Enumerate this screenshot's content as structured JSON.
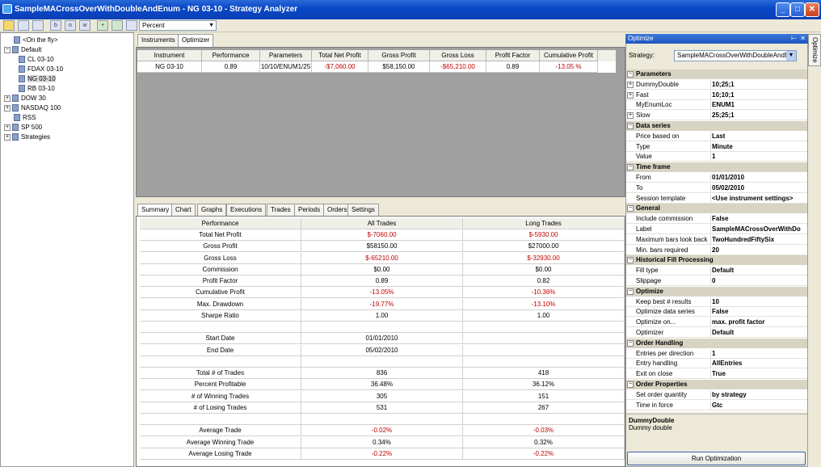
{
  "window": {
    "title": "SampleMACrossOverWithDoubleAndEnum - NG 03-10 - Strategy Analyzer"
  },
  "toolbar": {
    "combo_value": "Percent"
  },
  "tree": [
    {
      "label": "<On the fly>",
      "level": 0
    },
    {
      "label": "Default",
      "level": 0
    },
    {
      "label": "CL 03-10",
      "level": 1
    },
    {
      "label": "FDAX 03-10",
      "level": 1
    },
    {
      "label": "NG 03-10",
      "level": 1
    },
    {
      "label": "RB 03-10",
      "level": 1
    },
    {
      "label": "DOW 30",
      "level": 0
    },
    {
      "label": "NASDAQ 100",
      "level": 0
    },
    {
      "label": "RSS",
      "level": 0
    },
    {
      "label": "SP 500",
      "level": 0
    },
    {
      "label": "Strategies",
      "level": 0
    }
  ],
  "top_tabs": [
    "Instruments",
    "Optimizer"
  ],
  "optimizer_table": {
    "headers": [
      "Instrument",
      "Performance",
      "Parameters",
      "Total Net Profit",
      "Gross Profit",
      "Gross Loss",
      "Profit Factor",
      "Cumulative Profit"
    ],
    "row": [
      "NG 03-10",
      "0.89",
      "10/10/ENUM1/25",
      "-$7,060.00",
      "$58,150.00",
      "-$65,210.00",
      "0.89",
      "-13.05 %"
    ]
  },
  "bottom_tabs": [
    "Summary",
    "Chart",
    "Graphs",
    "Executions",
    "Trades",
    "Periods",
    "Orders",
    "Settings"
  ],
  "summary": {
    "headers": [
      "Performance",
      "All Trades",
      "Long Trades"
    ],
    "rows": [
      [
        "Total Net Profit",
        "$-7060.00",
        "$-5930.00"
      ],
      [
        "Gross Profit",
        "$58150.00",
        "$27000.00"
      ],
      [
        "Gross Loss",
        "$-65210.00",
        "$-32930.00"
      ],
      [
        "Commission",
        "$0.00",
        "$0.00"
      ],
      [
        "Profit Factor",
        "0.89",
        "0.82"
      ],
      [
        "Cumulative Profit",
        "-13.05%",
        "-10.36%"
      ],
      [
        "Max. Drawdown",
        "-19.77%",
        "-13.10%"
      ],
      [
        "Sharpe Ratio",
        "1.00",
        "1.00"
      ],
      [
        "",
        "",
        ""
      ],
      [
        "Start Date",
        "01/01/2010",
        ""
      ],
      [
        "End Date",
        "05/02/2010",
        ""
      ],
      [
        "",
        "",
        ""
      ],
      [
        "Total # of Trades",
        "836",
        "418"
      ],
      [
        "Percent Profitable",
        "36.48%",
        "36.12%"
      ],
      [
        "# of Winning Trades",
        "305",
        "151"
      ],
      [
        "# of Losing Trades",
        "531",
        "267"
      ],
      [
        "",
        "",
        ""
      ],
      [
        "Average Trade",
        "-0.02%",
        "-0.03%"
      ],
      [
        "Average Winning Trade",
        "0.34%",
        "0.32%"
      ],
      [
        "Average Losing Trade",
        "-0.22%",
        "-0.22%"
      ]
    ]
  },
  "optimize_panel": {
    "title": "Optimize",
    "side_tab": "Optimize",
    "strategy_label": "Strategy:",
    "strategy_value": "SampleMACrossOverWithDoubleAndE",
    "grid": [
      {
        "cat": "Parameters"
      },
      {
        "k": "DummyDouble",
        "v": "10;25;1",
        "exp": true
      },
      {
        "k": "Fast",
        "v": "10;10;1",
        "exp": true
      },
      {
        "k": "MyEnumLoc",
        "v": "ENUM1"
      },
      {
        "k": "Slow",
        "v": "25;25;1",
        "exp": true
      },
      {
        "cat": "Data series"
      },
      {
        "k": "Price based on",
        "v": "Last"
      },
      {
        "k": "Type",
        "v": "Minute"
      },
      {
        "k": "Value",
        "v": "1"
      },
      {
        "cat": "Time frame"
      },
      {
        "k": "From",
        "v": "01/01/2010"
      },
      {
        "k": "To",
        "v": "05/02/2010"
      },
      {
        "k": "Session template",
        "v": "<Use instrument settings>"
      },
      {
        "cat": "General"
      },
      {
        "k": "Include commission",
        "v": "False"
      },
      {
        "k": "Label",
        "v": "SampleMACrossOverWithDo"
      },
      {
        "k": "Maximum bars look back",
        "v": "TwoHundredFiftySix"
      },
      {
        "k": "Min. bars required",
        "v": "20"
      },
      {
        "cat": "Historical Fill Processing"
      },
      {
        "k": "Fill type",
        "v": "Default"
      },
      {
        "k": "Slippage",
        "v": "0"
      },
      {
        "cat": "Optimize"
      },
      {
        "k": "Keep best # results",
        "v": "10"
      },
      {
        "k": "Optimize data series",
        "v": "False"
      },
      {
        "k": "Optimize on...",
        "v": "max. profit factor"
      },
      {
        "k": "Optimizer",
        "v": "Default"
      },
      {
        "cat": "Order Handling"
      },
      {
        "k": "Entries per direction",
        "v": "1"
      },
      {
        "k": "Entry handling",
        "v": "AllEntries"
      },
      {
        "k": "Exit on close",
        "v": "True"
      },
      {
        "cat": "Order Properties"
      },
      {
        "k": "Set order quantity",
        "v": "by strategy"
      },
      {
        "k": "Time in force",
        "v": "Gtc"
      }
    ],
    "desc_title": "DummyDouble",
    "desc_text": "Dummy double",
    "run_label": "Run Optimization"
  },
  "colors": {
    "negative": "#c00000",
    "titlebar": "#0a48c8"
  }
}
